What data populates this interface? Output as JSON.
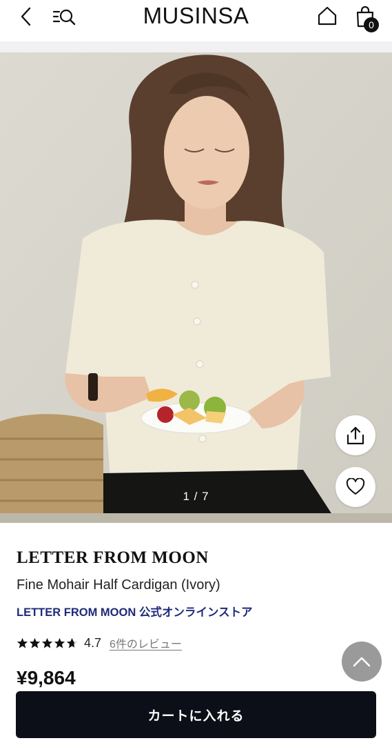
{
  "header": {
    "logo": "MUSINSA",
    "cart_count": "0",
    "icons": [
      "back-chevron-icon",
      "menu-search-icon",
      "home-icon",
      "shopping-bag-icon"
    ]
  },
  "gallery": {
    "counter": "1 / 7",
    "share_icon": "share-icon",
    "like_icon": "heart-icon"
  },
  "product": {
    "brand": "LETTER FROM MOON",
    "name": "Fine Mohair Half Cardigan (Ivory)",
    "store": "LETTER FROM MOON 公式オンラインストア",
    "rating": "4.7",
    "reviews": "6件のレビュー",
    "price": "¥9,864"
  },
  "actions": {
    "add_to_cart": "カートに入れる"
  },
  "colors": {
    "store_link": "#1e2a7a",
    "button_bg": "#0c0f17",
    "scroll_top_bg": "#9a9a9a"
  }
}
